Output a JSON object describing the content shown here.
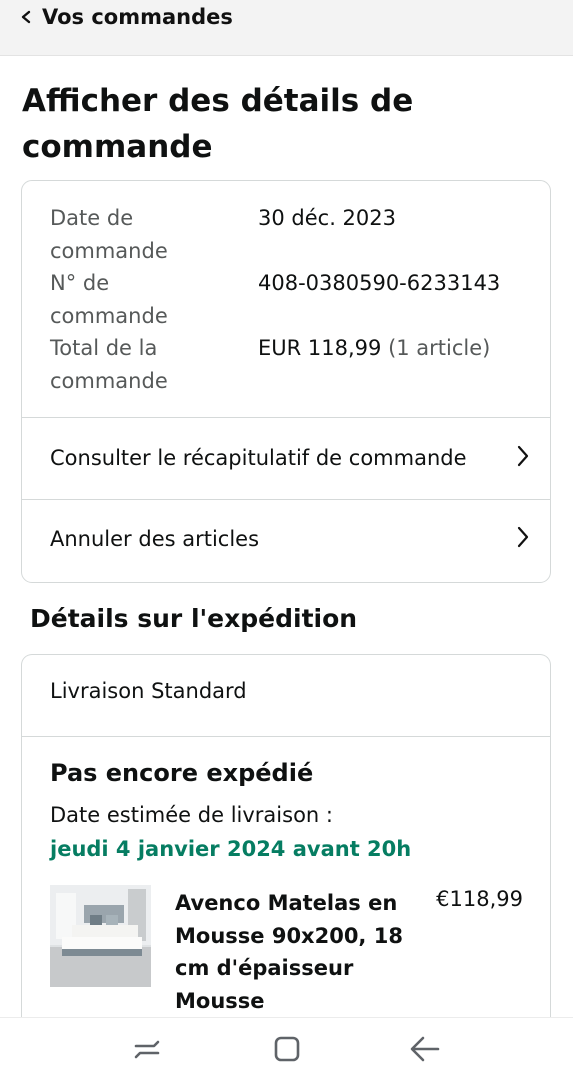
{
  "header": {
    "back_label": "Vos commandes"
  },
  "page": {
    "title": "Afficher des détails de commande"
  },
  "order_info": {
    "date_label": "Date de commande",
    "date_value": "30 déc. 2023",
    "number_label": "N° de commande",
    "number_value": "408-0380590-6233143",
    "total_label": "Total de la commande",
    "total_value": "EUR 118,99",
    "total_items": "(1 article)"
  },
  "actions": {
    "summary_label": "Consulter le récapitulatif de commande",
    "cancel_label": "Annuler des articles"
  },
  "shipping": {
    "section_title": "Détails sur l'expédition",
    "method": "Livraison Standard",
    "status": "Pas encore expédié",
    "eta_label": "Date estimée de livraison :",
    "eta_date": "jeudi 4 janvier 2024 avant 20h",
    "eta_color": "#067d62"
  },
  "product": {
    "title": "Avenco Matelas en Mousse 90x200, 18 cm d'épaisseur Mousse",
    "price": "€118,99"
  },
  "system_nav": {
    "icons": [
      "recents-icon",
      "home-icon",
      "back-icon"
    ]
  }
}
